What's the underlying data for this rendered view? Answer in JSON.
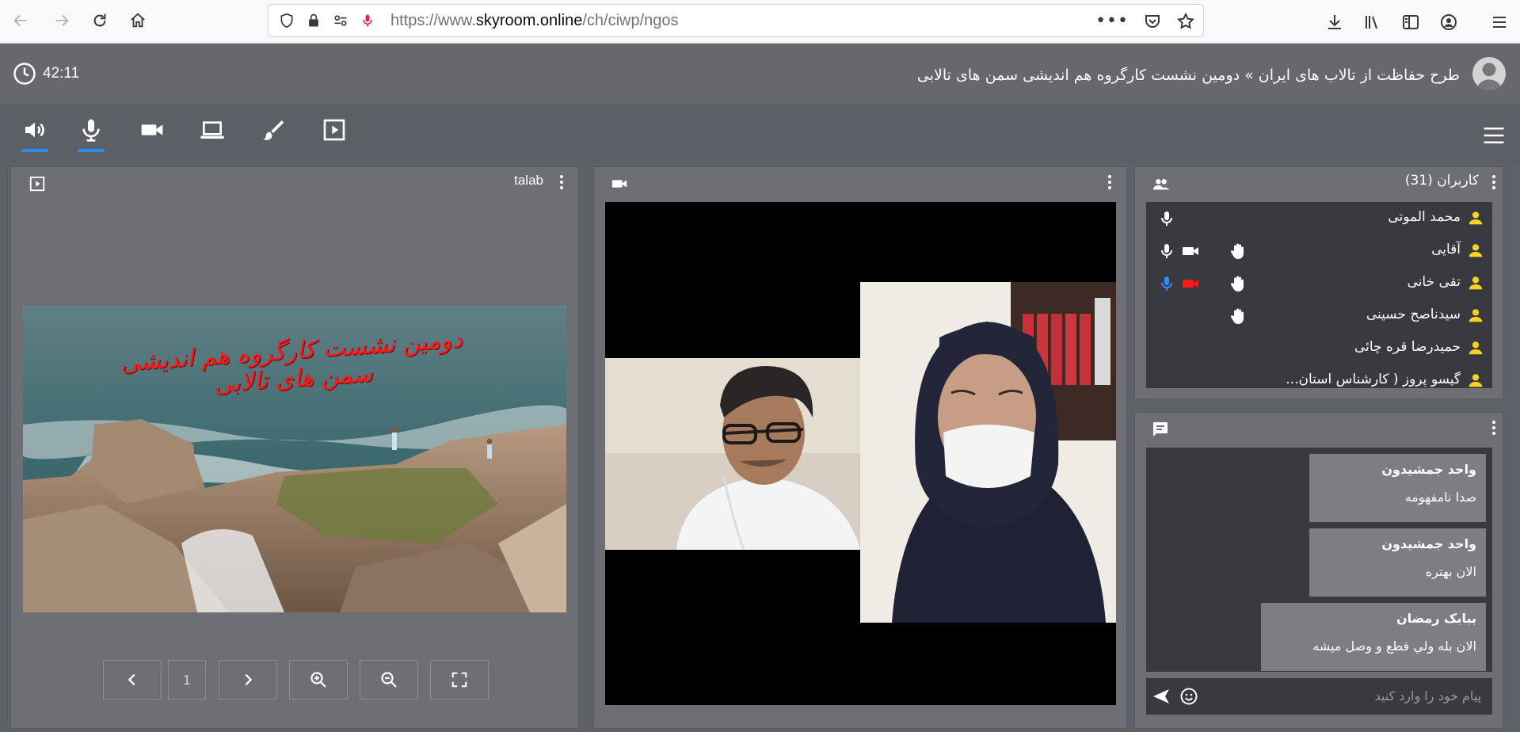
{
  "browser": {
    "url_prefix": "https://www.",
    "url_domain": "skyroom.online",
    "url_path": "/ch/ciwp/ngos"
  },
  "header": {
    "timer": "42:11",
    "title": "طرح حفاظت از تالاب های ایران » دومین نشست کارگروه هم اندیشی سمن های تالابی"
  },
  "presentation": {
    "name": "talab",
    "slide_title": "دومین نشست کارگروه هم اندیشی سمن های تالابی",
    "page_number": "1"
  },
  "users": {
    "header": "کاربران (31)",
    "items": [
      {
        "name": "محمد الموتی",
        "mic": true,
        "mic_color": "#ffffff",
        "camera": false,
        "hand": false
      },
      {
        "name": "آقایی",
        "mic": true,
        "mic_color": "#ffffff",
        "camera": true,
        "camera_color": "#ffffff",
        "hand": true
      },
      {
        "name": "تقی خانی",
        "mic": true,
        "mic_color": "#2f8cf0",
        "camera": true,
        "camera_color": "#ff1a1a",
        "hand": true
      },
      {
        "name": "سیدناصح حسینی",
        "mic": false,
        "camera": false,
        "hand": true
      },
      {
        "name": "حمیدرضا قره چائی",
        "mic": false,
        "camera": false,
        "hand": false
      },
      {
        "name": "گیسو پروز ( کارشناس استان...",
        "mic": false,
        "camera": false,
        "hand": false
      }
    ]
  },
  "chat": {
    "messages": [
      {
        "author": "واحد جمشیدون",
        "text": "صدا نامفهومه"
      },
      {
        "author": "واحد جمشیدون",
        "text": "الان بهتره"
      },
      {
        "author": "ببابک رمضان",
        "text": "الان بله ولي قطع و وصل میشه"
      }
    ],
    "input_placeholder": "پیام خود را وارد کنید"
  },
  "colors": {
    "accent": "#2f8cf0",
    "user_icon": "#ffd21f",
    "alert": "#ff1a1a"
  }
}
